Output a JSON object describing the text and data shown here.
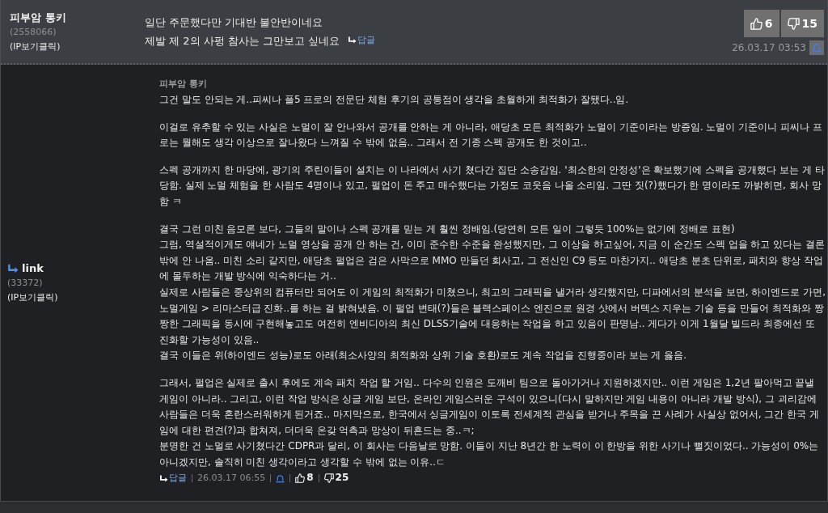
{
  "comments": [
    {
      "kind": "comment",
      "author": "피부암 통키",
      "user_id": "(2558066)",
      "ip_link": "(IP보기클릭)",
      "lines": [
        "일단 주문했다만 기대반 불안반이네요",
        "제발 제 2의 사펑 참사는 그만보고 싶네요"
      ],
      "reply_link": "답글",
      "upvotes": "6",
      "downvotes": "15",
      "timestamp": "26.03.17 03:53"
    },
    {
      "kind": "reply",
      "author": "link",
      "user_id": "(33372)",
      "ip_link": "(IP보기클릭)",
      "reply_to": "피부암 통키",
      "paragraphs": [
        [
          "그건 말도 안되는 게..피씨나 플5 프로의 전문단 체험 후기의 공통점이 생각을 초월하게 최적화가 잘됐다..임."
        ],
        [
          "이걸로 유추할 수 있는 사실은 노멀이 잘 안나와서 공개를 안하는 게 아니라, 애당초 모든 최적화가 노멀이 기준이라는 방증임. 노멀이 기준이니 피씨나 프로는 뭘해도 생각 이상으로 잘나왔다 느껴질 수 밖에 없음.. 그래서 전 기종 스펙 공개도 한 것이고.."
        ],
        [
          "스펙 공개까지 한 마당에, 광기의 주린이들이 설치는 이 나라에서 사기 쳤다간 집단 소송감임. '최소한의 안정성'은 확보했기에 스펙을 공개했다 보는 게 타당함. 실제 노멀 체험을 한 사람도 4명이나 있고, 펄업이 돈 주고 매수했다는 가정도 코웃음 나올 소리임. 그딴 짓(?)했다가 한 명이라도 까밝히면, 회사 망함 ㅋ"
        ],
        [
          "결국 그런 미친 음모론 보다, 그들의 말이나 스펙 공개를 믿는 게 훨씬 정배임.(당연히 모든 일이 그렇듯 100%는 없기에 정배로 표현)",
          "그럼, 역설적이게도 얘네가 노멀 영상을 공개 안 하는 건, 이미 준수한 수준을 완성했지만, 그 이상을 하고싶어, 지금 이 순간도 스펙 업을 하고 있다는 결론 밖에 안 나옴.. 미친 소리 같지만, 애당초 펄업은 검은 사막으로 MMO 만들던 회사고, 그 전신인 C9 등도 마찬가지.. 애당초 분초 단위로, 패치와 향상 작업에 몰두하는 개발 방식에 익숙하다는 거..",
          "실제로 사람들은 중상위의 컴퓨터만 되어도 이 게임의 최적화가 미쳤으니, 최고의 그래픽을 낼거라 생각했지만, 디파에서의 분석을 보면, 하이엔드로 가면, 노멀게임 > 리마스터급 진화..를 하는 걸 밝혀냈음. 이 펄업 변태(?)들은 블랙스페이스 엔진으로 원경 샷에서 버텍스 지우는 기술 등을 만들어 최적화와 짱짱한 그래픽을 동시에 구현해놓고도 여전히 엔비디아의 최신 DLSS기술에 대응하는 작업을 하고 있음이 판명남.. 게다가 이게 1월달 빌드라 최종에선 또 진화할 가능성이 있음..",
          "결국 이들은 위(하이엔드 성능)로도 아래(최소사양의 최적화와 상위 기술 호환)로도 계속 작업을 진행중이라 보는 게 옳음."
        ],
        [
          "그래서, 펄업은 실제로 출시 후에도 계속 패치 작업 할 거임.. 다수의 인원은 도깨비 팀으로 돌아가거나 지원하겠지만.. 이런 게임은 1,2년 팔아먹고 끝낼 게임이 아니라.. 그리고, 이런 작업 방식은 싱글 게임 보단, 온라인 게임스러운 구석이 있으니(다시 말하지만 게임 내용이 아니라 개발 방식), 그 괴리감에 사람들은 더욱 혼란스러워하게 된거죠.. 마지막으로, 한국에서 싱글게임이 이토록 전세계적 관심을 받거나 주목을 끈 사례가 사실상 없어서, 그간 한국 게임에 대한 편견(?)과 합쳐져, 더더욱 온갖 억측과 망상이 뒤흔드는 중..ㅋ;",
          "분명한 건 노멀로 사기쳤다간 CDPR과 달리, 이 회사는 다음날로 망함. 이들이 지난 8년간 한 노력이 이 한방을 위한 사기나 뻘짓이었다.. 가능성이 0%는 아니겠지만, 솔직히 미친 생각이라고 생각할 수 밖에 없는 이유..ㄷ"
        ]
      ],
      "reply_link": "답글",
      "timestamp": "26.03.17 06:55",
      "upvotes": "8",
      "downvotes": "25"
    }
  ]
}
